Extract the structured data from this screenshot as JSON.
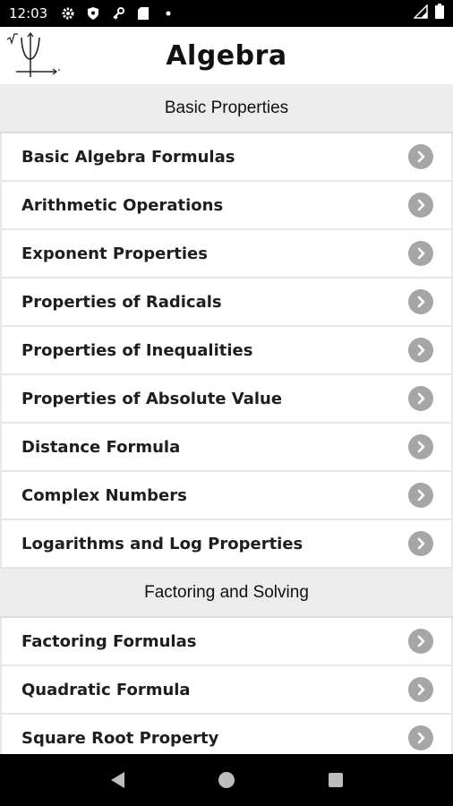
{
  "status_bar": {
    "time": "12:03",
    "icons": [
      "settings-icon",
      "shield-icon",
      "key-icon",
      "sd-card-icon",
      "dot-icon"
    ],
    "right_icons": [
      "signal-icon",
      "battery-icon"
    ]
  },
  "header": {
    "title": "Algebra",
    "logo": "graph-logo-icon"
  },
  "sections": [
    {
      "title": "Basic Properties",
      "items": [
        "Basic Algebra Formulas",
        "Arithmetic Operations",
        "Exponent Properties",
        "Properties of Radicals",
        "Properties of Inequalities",
        "Properties of Absolute Value",
        "Distance Formula",
        "Complex Numbers",
        "Logarithms and Log Properties"
      ]
    },
    {
      "title": "Factoring and Solving",
      "items": [
        "Factoring Formulas",
        "Quadratic Formula",
        "Square Root Property"
      ]
    }
  ],
  "nav": [
    "back-icon",
    "home-icon",
    "recents-icon"
  ],
  "colors": {
    "chevron": "#a6a6a6",
    "section_bg": "#ececec",
    "item_bg": "#ffffff"
  }
}
